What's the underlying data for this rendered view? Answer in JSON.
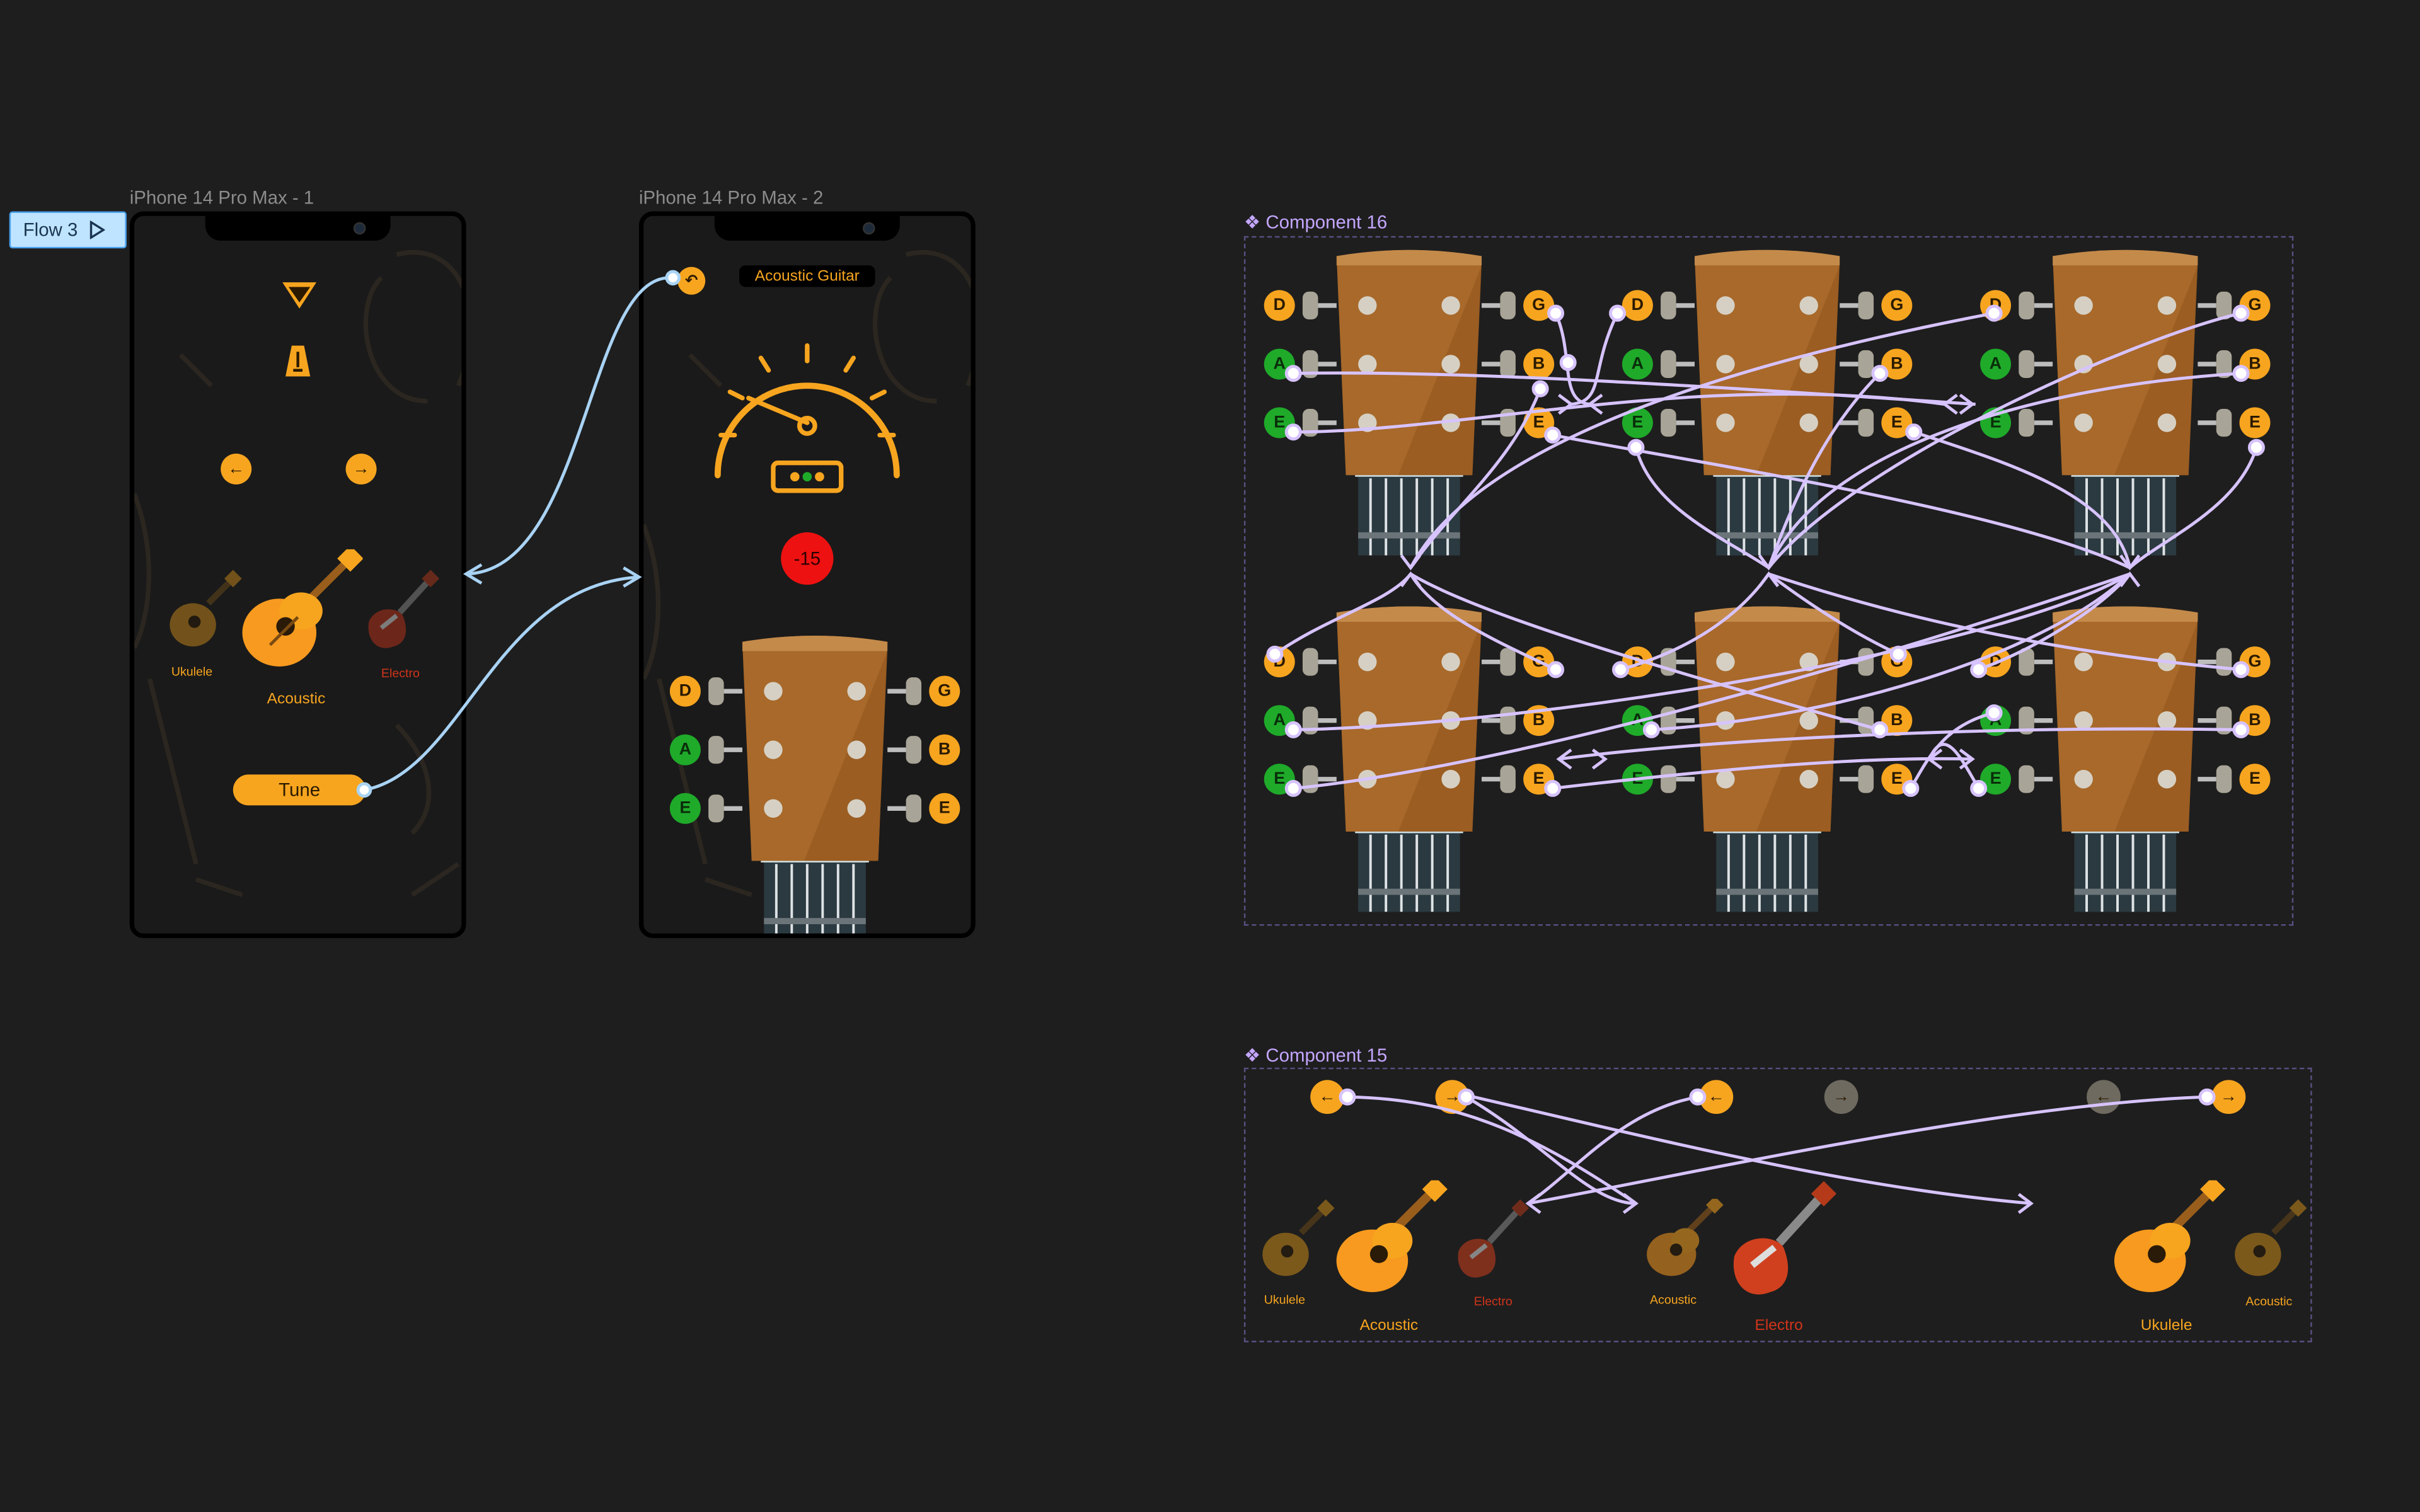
{
  "canvas": {
    "flow_label": "Flow 3"
  },
  "frame1": {
    "title": "iPhone 14 Pro Max - 1",
    "instruments": {
      "left": "Ukulele",
      "center": "Acoustic",
      "right": "Electro"
    },
    "tune_label": "Tune"
  },
  "frame2": {
    "title": "iPhone 14 Pro Max - 2",
    "header": "Acoustic Guitar",
    "deviation": "-15",
    "pegs_left": [
      "D",
      "A",
      "E"
    ],
    "pegs_right": [
      "G",
      "B",
      "E"
    ]
  },
  "component16": {
    "title": "Component 16",
    "headstocks": [
      {
        "left": [
          "D",
          "A",
          "E"
        ],
        "right": [
          "G",
          "B",
          "E"
        ]
      },
      {
        "left": [
          "D",
          "A",
          "E"
        ],
        "right": [
          "G",
          "B",
          "E"
        ]
      },
      {
        "left": [
          "D",
          "A",
          "E"
        ],
        "right": [
          "G",
          "B",
          "E"
        ]
      },
      {
        "left": [
          "D",
          "A",
          "E"
        ],
        "right": [
          "G",
          "B",
          "E"
        ]
      },
      {
        "left": [
          "D",
          "A",
          "E"
        ],
        "right": [
          "G",
          "B",
          "E"
        ]
      },
      {
        "left": [
          "D",
          "A",
          "E"
        ],
        "right": [
          "G",
          "B",
          "E"
        ]
      }
    ]
  },
  "component15": {
    "title": "Component 15",
    "variants": [
      {
        "left": "Ukulele",
        "center": "Acoustic",
        "right": "Electro"
      },
      {
        "left": "Acoustic",
        "center": "Electro",
        "right": ""
      },
      {
        "left": "",
        "center": "Ukulele",
        "right": "Acoustic"
      }
    ]
  },
  "colors": {
    "canvas": "#1e1e1e",
    "accent": "#f7a51f",
    "green": "#1faa2a",
    "red": "#ee1111",
    "prototype_link": "#a9d3f5",
    "component_link": "#d7c3ff",
    "component_label": "#c4a6ff"
  },
  "icons": [
    "tuner-logo-icon",
    "metronome-icon",
    "arrow-left-icon",
    "arrow-right-icon",
    "back-icon",
    "gauge-icon",
    "guitar-headstock-icon",
    "ukulele-icon",
    "acoustic-guitar-icon",
    "electric-guitar-icon"
  ]
}
